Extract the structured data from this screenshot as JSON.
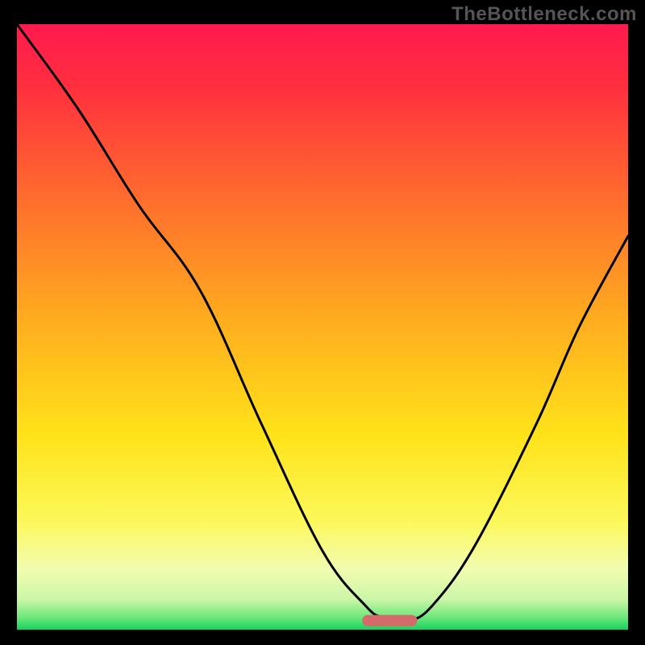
{
  "watermark": "TheBottleneck.com",
  "chart_data": {
    "type": "line",
    "title": "",
    "xlabel": "",
    "ylabel": "",
    "xlim": [
      0,
      100
    ],
    "ylim": [
      0,
      100
    ],
    "series": [
      {
        "name": "bottleneck-curve",
        "x": [
          0,
          10,
          20,
          30,
          40,
          50,
          57,
          60,
          64,
          68,
          75,
          85,
          92,
          100
        ],
        "y": [
          100,
          86,
          70,
          56,
          34,
          13,
          4,
          2,
          1.5,
          4,
          14,
          34,
          50,
          65
        ]
      }
    ],
    "marker": {
      "name": "target-pill",
      "color": "#d46a6a",
      "x_center": 61,
      "width": 9,
      "y": 1.5
    },
    "background_gradient_stops": [
      {
        "pos": 0.0,
        "color": "#ff1a4f"
      },
      {
        "pos": 0.1,
        "color": "#ff2e3f"
      },
      {
        "pos": 0.28,
        "color": "#ff6a2e"
      },
      {
        "pos": 0.5,
        "color": "#ffb01e"
      },
      {
        "pos": 0.68,
        "color": "#ffe31a"
      },
      {
        "pos": 0.82,
        "color": "#fcf85a"
      },
      {
        "pos": 0.9,
        "color": "#f2fcb0"
      },
      {
        "pos": 0.95,
        "color": "#cbf6a7"
      },
      {
        "pos": 0.98,
        "color": "#6de77a"
      },
      {
        "pos": 1.0,
        "color": "#15d15f"
      }
    ]
  }
}
